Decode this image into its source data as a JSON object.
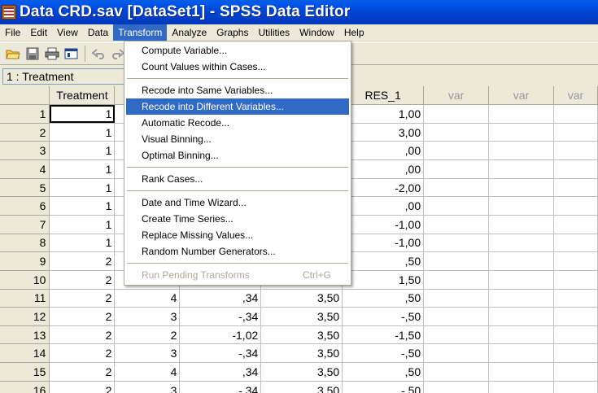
{
  "window": {
    "title": "Data CRD.sav [DataSet1] - SPSS Data Editor"
  },
  "menubar": [
    "File",
    "Edit",
    "View",
    "Data",
    "Transform",
    "Analyze",
    "Graphs",
    "Utilities",
    "Window",
    "Help"
  ],
  "active_menu": "Transform",
  "cell_ref": "1 : Treatment",
  "columns": [
    "Treatment",
    "",
    "",
    "",
    "RES_1",
    "var",
    "var",
    "var"
  ],
  "rows": [
    {
      "n": "1",
      "c": [
        "1",
        "",
        "",
        "",
        "1,00"
      ]
    },
    {
      "n": "2",
      "c": [
        "1",
        "",
        "",
        "",
        "3,00"
      ]
    },
    {
      "n": "3",
      "c": [
        "1",
        "",
        "",
        "",
        ",00"
      ]
    },
    {
      "n": "4",
      "c": [
        "1",
        "",
        "",
        "",
        ",00"
      ]
    },
    {
      "n": "5",
      "c": [
        "1",
        "",
        "",
        "",
        "-2,00"
      ]
    },
    {
      "n": "6",
      "c": [
        "1",
        "",
        "",
        "",
        ",00"
      ]
    },
    {
      "n": "7",
      "c": [
        "1",
        "",
        "",
        "",
        "-1,00"
      ]
    },
    {
      "n": "8",
      "c": [
        "1",
        "",
        "",
        "",
        "-1,00"
      ]
    },
    {
      "n": "9",
      "c": [
        "2",
        "",
        "",
        "",
        ",50"
      ]
    },
    {
      "n": "10",
      "c": [
        "2",
        "",
        "",
        "",
        "1,50"
      ]
    },
    {
      "n": "11",
      "c": [
        "2",
        "4",
        ",34",
        "3,50",
        ",50"
      ]
    },
    {
      "n": "12",
      "c": [
        "2",
        "3",
        "-,34",
        "3,50",
        "-,50"
      ]
    },
    {
      "n": "13",
      "c": [
        "2",
        "2",
        "-1,02",
        "3,50",
        "-1,50"
      ]
    },
    {
      "n": "14",
      "c": [
        "2",
        "3",
        "-,34",
        "3,50",
        "-,50"
      ]
    },
    {
      "n": "15",
      "c": [
        "2",
        "4",
        ",34",
        "3,50",
        ",50"
      ]
    },
    {
      "n": "16",
      "c": [
        "2",
        "3",
        "-,34",
        "3,50",
        "-,50"
      ]
    }
  ],
  "transform_menu": {
    "items": [
      {
        "label": "Compute Variable..."
      },
      {
        "label": "Count Values within Cases..."
      },
      {
        "label": "Recode into Same Variables..."
      },
      {
        "label": "Recode into Different Variables...",
        "highlighted": true
      },
      {
        "label": "Automatic Recode..."
      },
      {
        "label": "Visual Binning..."
      },
      {
        "label": "Optimal Binning..."
      },
      {
        "label": "Rank Cases..."
      },
      {
        "label": "Date and Time Wizard..."
      },
      {
        "label": "Create Time Series..."
      },
      {
        "label": "Replace Missing Values..."
      },
      {
        "label": "Random Number Generators..."
      },
      {
        "label": "Run Pending Transforms",
        "shortcut": "Ctrl+G",
        "disabled": true
      }
    ]
  },
  "toolbar_icons": [
    "open-folder-icon",
    "save-icon",
    "print-icon",
    "dialog-recall-icon",
    "undo-icon",
    "redo-icon"
  ],
  "colors": {
    "titlebar": "#0046D5",
    "highlight": "#316AC5",
    "chrome": "#ECE9D8"
  }
}
